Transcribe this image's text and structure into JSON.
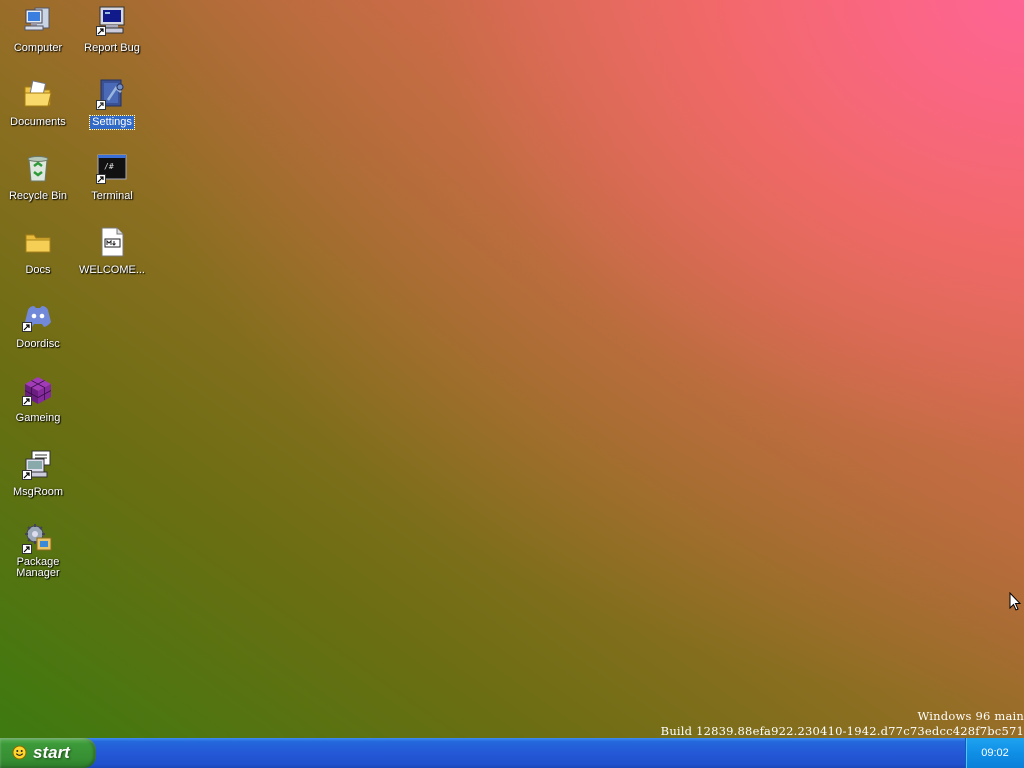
{
  "desktop": {
    "icons": [
      {
        "label": "Computer",
        "icon": "computer-icon",
        "selected": false
      },
      {
        "label": "Report Bug",
        "icon": "report-bug-icon",
        "selected": false,
        "shortcut": true
      },
      {
        "label": "Documents",
        "icon": "documents-folder-icon",
        "selected": false
      },
      {
        "label": "Settings",
        "icon": "settings-icon",
        "selected": true,
        "shortcut": true
      },
      {
        "label": "Recycle Bin",
        "icon": "recycle-bin-icon",
        "selected": false
      },
      {
        "label": "Terminal",
        "icon": "terminal-icon",
        "selected": false,
        "shortcut": true
      },
      {
        "label": "Docs",
        "icon": "folder-icon",
        "selected": false
      },
      {
        "label": "WELCOME...",
        "icon": "markdown-file-icon",
        "selected": false
      },
      {
        "label": "Doordisc",
        "icon": "doordisc-icon",
        "selected": false,
        "shortcut": true
      },
      {
        "label": "Gameing",
        "icon": "game-cube-icon",
        "selected": false,
        "shortcut": true
      },
      {
        "label": "MsgRoom",
        "icon": "msgroom-icon",
        "selected": false,
        "shortcut": true
      },
      {
        "label": "Package Manager",
        "icon": "package-manager-icon",
        "selected": false,
        "shortcut": true
      }
    ],
    "build_line1": "Windows 96 main",
    "build_line2": "Build 12839.88efa922.230410-1942.d77c73edcc428f7bc571"
  },
  "taskbar": {
    "start_label": "start",
    "clock": "09:02"
  },
  "colors": {
    "taskbar_blue": "#2458d6",
    "start_green": "#3c9a39",
    "tray_blue": "#0f8fe6",
    "selection_blue": "#3169c6"
  }
}
